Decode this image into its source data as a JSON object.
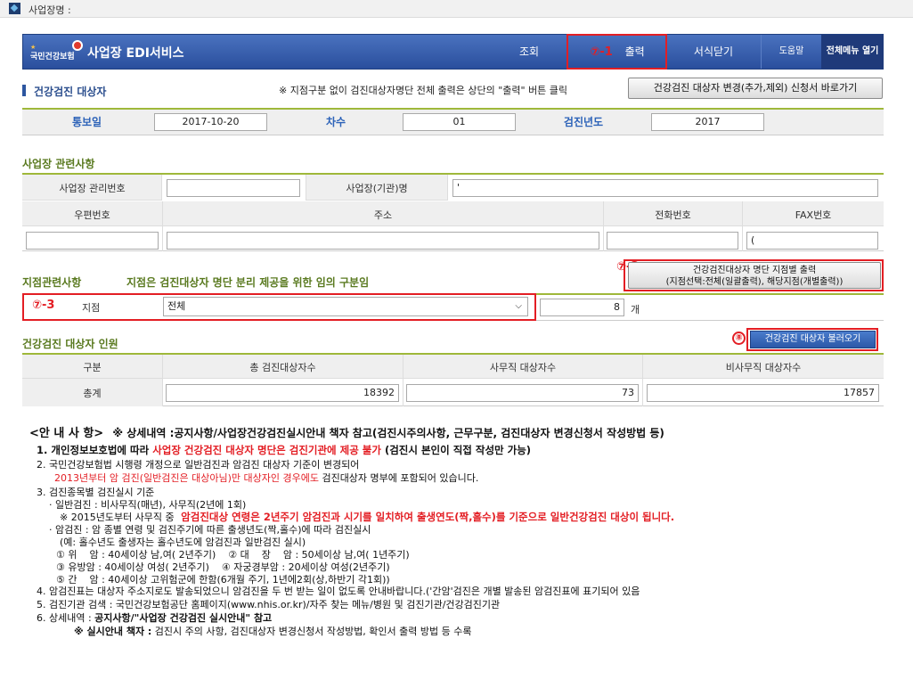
{
  "topbar": {
    "label": "사업장명 :"
  },
  "header": {
    "logo_text": "국민건강보험",
    "title": "사업장 EDI서비스",
    "nav": {
      "inquiry": "조회",
      "print_marker": "⑦-1",
      "print": "출력",
      "close_form": "서식닫기",
      "help": "도움말",
      "all_menu": "전체메뉴 열기"
    }
  },
  "section": {
    "title": "건강검진 대상자",
    "info": "※ 지점구분 없이 검진대상자명단 전체 출력은 상단의 \"출력\" 버튼 클릭",
    "change_button": "건강검진 대상자 변경(추가,제외) 신청서 바로가기"
  },
  "info_row": {
    "notice_date_label": "통보일",
    "notice_date": "2017-10-20",
    "round_label": "차수",
    "round": "01",
    "year_label": "검진년도",
    "year": "2017"
  },
  "workplace": {
    "title": "사업장 관련사항",
    "mgmt_no_label": "사업장 관리번호",
    "mgmt_no": "",
    "name_label": "사업장(기관)명",
    "name": "'",
    "zip_label": "우편번호",
    "zip": "",
    "addr_label": "주소",
    "addr": "",
    "phone_label": "전화번호",
    "phone": "",
    "fax_label": "FAX번호",
    "fax": "("
  },
  "branch": {
    "title": "지점관련사항",
    "subtitle": "지점은 검진대상자 명단 분리 제공을 위한 임의 구분임",
    "print_marker": "⑦-2",
    "print_button_line1": "건강검진대상자 명단 지점별 출력",
    "print_button_line2": "(지점선택:전체(일괄출력), 해당지점(개별출력))",
    "select_marker": "⑦-3",
    "label": "지점",
    "selected": "전체",
    "count": "8",
    "count_unit": "개"
  },
  "count_section": {
    "title": "건강검진 대상자 인원",
    "load_marker": "⑧",
    "load_button": "건강검진 대상자 불러오기",
    "col_type": "구분",
    "col_total": "총 검진대상자수",
    "col_office": "사무직 대상자수",
    "col_nonoffice": "비사무직 대상자수",
    "row_label": "총계",
    "total": "18392",
    "office": "73",
    "nonoffice": "17857"
  },
  "notice": {
    "head": "<안 내 사 항>",
    "head_detail": "※ 상세내역 :공지사항/사업장건강검진실시안내 책자 참고(검진시주의사항, 근무구분, 검진대상자 변경신청서 작성방법 등)",
    "l1a": "1. 개인정보보호법에 따라 ",
    "l1b": "사업장 건강검진 대상자 명단은 검진기관에 제공 불가",
    "l1c": " (검진시 본인이 직접 작성만 가능)",
    "l2": "2. 국민건강보험법 시행령 개정으로 일반검진과 암검진 대상자 기준이 변경되어",
    "l2b_red": "2013년부터 암 검진(일반검진은 대상아님)만 대상자인 경우에도",
    "l2b": " 검진대상자 명부에 포함되어 있습니다.",
    "l3": "3. 검진종목별 검진실시 기준",
    "l3a": "· 일반검진 : 비사무직(매년), 사무직(2년에 1회)",
    "l3b": "※ 2015년도부터 사무직 중",
    "l3b_red": "암검진대상 연령은 2년주기 암검진과 시기를 일치하여 출생연도(짝,홀수)를 기준으로 일반건강검진 대상이 됩니다.",
    "l3c": "· 암검진 : 암 종별 연령 및 검진주기에 따른 출생년도(짝,홀수)에 따라 검진실시",
    "l3d": "(예: 홀수년도 출생자는 홀수년도에 암검진과 일반검진 실시)",
    "l3e": "① 위    암 : 40세이상 남,여( 2년주기)    ② 대    장    암 : 50세이상 남,여( 1년주기)",
    "l3f": "③ 유방암 : 40세이상 여성( 2년주기)    ④ 자궁경부암 : 20세이상 여성(2년주기)",
    "l3g": "⑤ 간    암 : 40세이상 고위험군에 한함(6개월 주기, 1년에2회(상,하반기 각1회))",
    "l4": "4. 암검진표는 대상자 주소지로도 발송되었으니 암검진을 두 번 받는 일이 없도록 안내바랍니다.('간암'검진은 개별 발송된  암검진표에 표기되어 있음",
    "l5": "5. 검진기관 검색 : 국민건강보험공단 홈페이지(www.nhis.or.kr)/자주 찾는 메뉴/병원 및 검진기관/건강검진기관",
    "l6a": "6. 상세내역 : ",
    "l6b": "공지사항/\"사업장 건강검진 실시안내\" 참고",
    "l7a": "※ 실시안내 책자 :",
    "l7b": " 검진시 주의 사항, 검진대상자 변경신청서 작성방법, 확인서 출력 방법 등 수록"
  }
}
